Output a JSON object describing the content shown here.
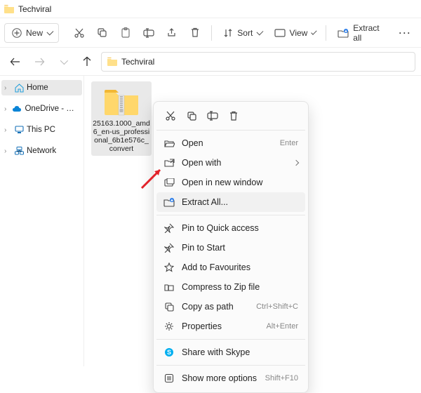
{
  "window": {
    "title": "Techviral"
  },
  "toolbar": {
    "new_label": "New",
    "sort_label": "Sort",
    "view_label": "View",
    "extract_all_label": "Extract all"
  },
  "address_bar": {
    "path": "Techviral"
  },
  "nav_pane": {
    "items": [
      {
        "label": "Home",
        "icon": "home"
      },
      {
        "label": "OneDrive - Personal",
        "icon": "cloud"
      },
      {
        "label": "This PC",
        "icon": "pc"
      },
      {
        "label": "Network",
        "icon": "network"
      }
    ]
  },
  "files": [
    {
      "name": "25163.1000_amd6_en-us_professional_6b1e576c_convert",
      "type": "zip"
    }
  ],
  "context_menu": {
    "items": [
      {
        "label": "Open",
        "shortcut": "Enter",
        "icon": "open"
      },
      {
        "label": "Open with",
        "submenu": true,
        "icon": "open-with"
      },
      {
        "label": "Open in new window",
        "icon": "new-window"
      },
      {
        "label": "Extract All...",
        "icon": "extract",
        "highlighted": true
      },
      {
        "sep": true
      },
      {
        "label": "Pin to Quick access",
        "icon": "pin"
      },
      {
        "label": "Pin to Start",
        "icon": "pin"
      },
      {
        "label": "Add to Favourites",
        "icon": "star"
      },
      {
        "label": "Compress to Zip file",
        "icon": "zip"
      },
      {
        "label": "Copy as path",
        "shortcut": "Ctrl+Shift+C",
        "icon": "copy-path"
      },
      {
        "label": "Properties",
        "shortcut": "Alt+Enter",
        "icon": "properties"
      },
      {
        "sep": true
      },
      {
        "label": "Share with Skype",
        "icon": "skype"
      },
      {
        "sep": true
      },
      {
        "label": "Show more options",
        "shortcut": "Shift+F10",
        "icon": "more"
      }
    ]
  }
}
